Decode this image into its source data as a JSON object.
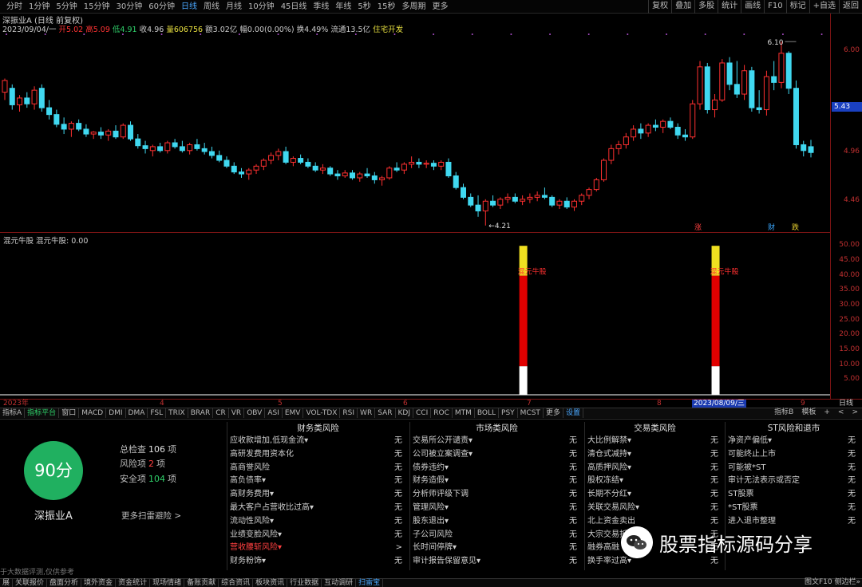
{
  "toolbar": {
    "periods": [
      "分时",
      "1分钟",
      "5分钟",
      "15分钟",
      "30分钟",
      "60分钟",
      "日线",
      "周线",
      "月线",
      "10分钟",
      "45日线",
      "季线",
      "年线",
      "5秒",
      "15秒",
      "多周期",
      "更多"
    ],
    "active_period": "日线",
    "buttons": [
      "复权",
      "叠加",
      "多股",
      "统计",
      "画线",
      "F10",
      "标记",
      "+自选",
      "返回"
    ]
  },
  "chart": {
    "title": "深振业A (日线 前复权)",
    "info": {
      "date": "2023/09/04/一",
      "open_label": "开",
      "open": "5.02",
      "high_label": "高",
      "high": "5.09",
      "low_label": "低",
      "low": "4.91",
      "close_label": "收",
      "close": "4.96",
      "volume_label": "量",
      "volume": "606756",
      "amount_label": "额",
      "amount": "3.02亿",
      "amplitude_label": "幅",
      "amplitude": "0.00(0.00%)",
      "turnover_label": "换",
      "turnover": "4.49%",
      "float_label": "流通",
      "float": "13.5亿",
      "sector": "住宅开发"
    },
    "price_ticks": [
      "6.00",
      "4.96",
      "4.46"
    ],
    "current_price_flag": "5.43",
    "high_note": "6.10",
    "low_note": "4.21",
    "event_marks": [
      "涨",
      "财",
      "跌"
    ],
    "indicator": {
      "title": "混元牛股 混元牛股: 0.00",
      "ticks": [
        "50.00",
        "45.00",
        "40.00",
        "35.00",
        "30.00",
        "25.00",
        "20.00",
        "15.00",
        "10.00",
        "5.00"
      ],
      "signal_label": "混元牛股"
    },
    "dates": [
      "2023年",
      "4",
      "5",
      "6",
      "7",
      "8",
      "2023/08/09/三",
      "9"
    ],
    "day_button": "日线"
  },
  "chart_data": {
    "type": "candlestick",
    "title": "深振业A (日线 前复权)",
    "ylim": [
      4.2,
      6.15
    ],
    "candles": [
      [
        5.58,
        5.72,
        5.5,
        5.7
      ],
      [
        5.62,
        5.66,
        5.4,
        5.45
      ],
      [
        5.45,
        5.55,
        5.38,
        5.52
      ],
      [
        5.52,
        5.58,
        5.42,
        5.46
      ],
      [
        5.46,
        5.64,
        5.4,
        5.6
      ],
      [
        5.62,
        5.66,
        5.38,
        5.42
      ],
      [
        5.42,
        5.5,
        5.3,
        5.35
      ],
      [
        5.35,
        5.4,
        5.22,
        5.25
      ],
      [
        5.25,
        5.32,
        5.15,
        5.2
      ],
      [
        5.2,
        5.28,
        5.12,
        5.26
      ],
      [
        5.26,
        5.3,
        5.18,
        5.2
      ],
      [
        5.2,
        5.25,
        5.12,
        5.15
      ],
      [
        5.15,
        5.18,
        5.1,
        5.17
      ],
      [
        5.17,
        5.22,
        5.1,
        5.14
      ],
      [
        5.14,
        5.2,
        5.08,
        5.18
      ],
      [
        5.18,
        5.24,
        5.1,
        5.12
      ],
      [
        5.12,
        5.26,
        5.1,
        5.24
      ],
      [
        5.24,
        5.28,
        5.08,
        5.1
      ],
      [
        5.1,
        5.15,
        5.0,
        5.03
      ],
      [
        5.03,
        5.08,
        4.95,
        5.0
      ],
      [
        4.98,
        5.04,
        4.92,
        5.02
      ],
      [
        5.02,
        5.06,
        4.96,
        4.98
      ],
      [
        4.98,
        5.08,
        4.95,
        5.06
      ],
      [
        5.06,
        5.1,
        5.0,
        5.02
      ],
      [
        5.02,
        5.08,
        4.96,
        4.98
      ],
      [
        4.98,
        5.06,
        4.94,
        5.04
      ],
      [
        5.04,
        5.1,
        4.98,
        5.0
      ],
      [
        5.0,
        5.06,
        4.94,
        4.97
      ],
      [
        4.97,
        5.02,
        4.9,
        4.93
      ],
      [
        4.93,
        4.98,
        4.86,
        4.88
      ],
      [
        4.88,
        4.92,
        4.8,
        4.82
      ],
      [
        4.82,
        4.86,
        4.74,
        4.76
      ],
      [
        4.76,
        4.8,
        4.7,
        4.74
      ],
      [
        4.74,
        4.8,
        4.68,
        4.78
      ],
      [
        4.78,
        4.84,
        4.74,
        4.82
      ],
      [
        4.82,
        4.9,
        4.78,
        4.88
      ],
      [
        4.88,
        4.96,
        4.84,
        4.93
      ],
      [
        4.93,
        5.0,
        4.88,
        4.97
      ],
      [
        4.97,
        5.02,
        4.84,
        4.86
      ],
      [
        4.86,
        4.92,
        4.82,
        4.9
      ],
      [
        4.9,
        4.94,
        4.84,
        4.86
      ],
      [
        4.86,
        4.9,
        4.8,
        4.82
      ],
      [
        4.82,
        4.86,
        4.76,
        4.78
      ],
      [
        4.78,
        4.84,
        4.74,
        4.8
      ],
      [
        4.8,
        4.82,
        4.72,
        4.74
      ],
      [
        4.74,
        4.78,
        4.68,
        4.72
      ],
      [
        4.72,
        4.78,
        4.7,
        4.75
      ],
      [
        4.75,
        4.78,
        4.68,
        4.7
      ],
      [
        4.7,
        4.76,
        4.66,
        4.74
      ],
      [
        4.74,
        4.8,
        4.7,
        4.72
      ],
      [
        4.72,
        4.76,
        4.64,
        4.68
      ],
      [
        4.68,
        4.72,
        4.62,
        4.7
      ],
      [
        4.7,
        4.82,
        4.68,
        4.8
      ],
      [
        4.8,
        4.86,
        4.76,
        4.78
      ],
      [
        4.78,
        4.86,
        4.74,
        4.84
      ],
      [
        4.84,
        4.92,
        4.8,
        4.86
      ],
      [
        4.86,
        4.9,
        4.8,
        4.84
      ],
      [
        4.84,
        4.88,
        4.8,
        4.85
      ],
      [
        4.85,
        4.88,
        4.78,
        4.82
      ],
      [
        4.82,
        4.88,
        4.78,
        4.86
      ],
      [
        4.86,
        4.9,
        4.7,
        4.72
      ],
      [
        4.72,
        4.76,
        4.58,
        4.6
      ],
      [
        4.6,
        4.64,
        4.48,
        4.5
      ],
      [
        4.5,
        4.54,
        4.4,
        4.42
      ],
      [
        4.42,
        4.52,
        4.3,
        4.36
      ],
      [
        4.36,
        4.48,
        4.21,
        4.46
      ],
      [
        4.46,
        4.52,
        4.4,
        4.42
      ],
      [
        4.42,
        4.5,
        4.38,
        4.48
      ],
      [
        4.48,
        4.54,
        4.44,
        4.5
      ],
      [
        4.5,
        4.54,
        4.44,
        4.46
      ],
      [
        4.46,
        4.52,
        4.42,
        4.48
      ],
      [
        4.48,
        4.54,
        4.44,
        4.5
      ],
      [
        4.5,
        4.56,
        4.46,
        4.52
      ],
      [
        4.52,
        4.6,
        4.48,
        4.5
      ],
      [
        4.5,
        4.52,
        4.4,
        4.42
      ],
      [
        4.42,
        4.48,
        4.38,
        4.46
      ],
      [
        4.46,
        4.5,
        4.38,
        4.4
      ],
      [
        4.4,
        4.48,
        4.36,
        4.46
      ],
      [
        4.46,
        4.54,
        4.42,
        4.52
      ],
      [
        4.52,
        4.6,
        4.48,
        4.58
      ],
      [
        4.58,
        4.7,
        4.56,
        4.68
      ],
      [
        4.68,
        4.9,
        4.66,
        4.88
      ],
      [
        4.88,
        5.04,
        4.84,
        5.0
      ],
      [
        5.0,
        5.08,
        4.94,
        5.04
      ],
      [
        5.04,
        5.16,
        5.0,
        5.12
      ],
      [
        5.12,
        5.24,
        5.08,
        5.2
      ],
      [
        5.2,
        5.26,
        5.1,
        5.16
      ],
      [
        5.16,
        5.26,
        5.12,
        5.24
      ],
      [
        5.24,
        5.3,
        5.18,
        5.22
      ],
      [
        5.22,
        5.3,
        5.16,
        5.28
      ],
      [
        5.28,
        5.32,
        5.2,
        5.22
      ],
      [
        5.22,
        5.26,
        5.1,
        5.14
      ],
      [
        5.14,
        5.2,
        5.08,
        5.12
      ],
      [
        5.12,
        5.5,
        5.1,
        5.46
      ],
      [
        5.46,
        5.9,
        5.4,
        5.84
      ],
      [
        5.84,
        5.88,
        5.36,
        5.4
      ],
      [
        5.4,
        5.56,
        5.32,
        5.5
      ],
      [
        5.5,
        5.92,
        5.48,
        5.88
      ],
      [
        5.88,
        5.94,
        5.6,
        5.66
      ],
      [
        5.66,
        5.9,
        5.52,
        5.56
      ],
      [
        5.56,
        5.86,
        5.5,
        5.8
      ],
      [
        5.8,
        5.84,
        5.38,
        5.42
      ],
      [
        5.42,
        5.6,
        5.36,
        5.4
      ],
      [
        5.4,
        5.8,
        5.34,
        5.74
      ],
      [
        5.74,
        5.9,
        5.6,
        5.68
      ],
      [
        5.68,
        6.1,
        5.62,
        5.98
      ],
      [
        5.98,
        6.0,
        5.56,
        5.62
      ],
      [
        5.62,
        5.7,
        5.0,
        5.04
      ],
      [
        5.04,
        5.08,
        4.92,
        4.98
      ],
      [
        5.02,
        5.09,
        4.91,
        4.96
      ]
    ],
    "indicator_signals": [
      {
        "at_candle": 70,
        "white_to": 9.6,
        "red_to": 40.0,
        "yellow_to": 50.0
      },
      {
        "at_candle": 96,
        "white_to": 9.6,
        "red_to": 40.0,
        "yellow_to": 50.0
      }
    ],
    "indicator_ylim": [
      0,
      53
    ]
  },
  "tabs": {
    "left": [
      "指标A",
      "指标平台",
      "窗口",
      "MACD",
      "DMI",
      "DMA",
      "FSL",
      "TRIX",
      "BRAR",
      "CR",
      "VR",
      "OBV",
      "ASI",
      "EMV",
      "VOL-TDX",
      "RSI",
      "WR",
      "SAR",
      "KDJ",
      "CCI",
      "ROC",
      "MTM",
      "BOLL",
      "PSY",
      "MCST",
      "更多",
      "设置"
    ],
    "right": [
      "指标B",
      "模板",
      "+",
      "<",
      ">"
    ]
  },
  "risk": {
    "score": "90分",
    "stock": "深振业A",
    "total_label": "总检查",
    "total": "106",
    "total_unit": "项",
    "risk_label": "风险项",
    "risk": "2",
    "risk_unit": "项",
    "safe_label": "安全项",
    "safe": "104",
    "safe_unit": "项",
    "more": "更多扫雷避险 >",
    "footnote": "于大数据评测,仅供参考",
    "columns": [
      {
        "title": "财务类风险",
        "rows": [
          {
            "name": "应收款增加,低现金流▾",
            "status": "无"
          },
          {
            "name": "高研发费用资本化",
            "status": "无"
          },
          {
            "name": "高商誉风险",
            "status": "无"
          },
          {
            "name": "高负债率▾",
            "status": "无"
          },
          {
            "name": "高财务费用▾",
            "status": "无"
          },
          {
            "name": "最大客户占营收比过高▾",
            "status": "无"
          },
          {
            "name": "流动性风险▾",
            "status": "无"
          },
          {
            "name": "业绩变脸风险▾",
            "status": "无"
          },
          {
            "name": "营收腰斩风险▾",
            "status": ">"
          },
          {
            "name": "财务粉饰▾",
            "status": "无"
          }
        ]
      },
      {
        "title": "市场类风险",
        "rows": [
          {
            "name": "交易所公开谴责▾",
            "status": "无"
          },
          {
            "name": "公司被立案调查▾",
            "status": "无"
          },
          {
            "name": "债券违约▾",
            "status": "无"
          },
          {
            "name": "财务造假▾",
            "status": "无"
          },
          {
            "name": "分析师评级下调",
            "status": "无"
          },
          {
            "name": "管理风险▾",
            "status": "无"
          },
          {
            "name": "股东退出▾",
            "status": "无"
          },
          {
            "name": "子公司风险",
            "status": "无"
          },
          {
            "name": "长时间停牌▾",
            "status": "无"
          },
          {
            "name": "审计报告保留意见▾",
            "status": "无"
          }
        ]
      },
      {
        "title": "交易类风险",
        "rows": [
          {
            "name": "大比例解禁▾",
            "status": "无"
          },
          {
            "name": "清仓式减持▾",
            "status": "无"
          },
          {
            "name": "高质押风险▾",
            "status": "无"
          },
          {
            "name": "股权冻结▾",
            "status": "无"
          },
          {
            "name": "长期不分红▾",
            "status": "无"
          },
          {
            "name": "关联交易风险▾",
            "status": "无"
          },
          {
            "name": "北上资金卖出",
            "status": "无"
          },
          {
            "name": "大宗交易折",
            "status": "无"
          },
          {
            "name": "融券高融",
            "status": "无"
          },
          {
            "name": "换手率过高▾",
            "status": "无"
          }
        ]
      },
      {
        "title": "ST风险和退市",
        "rows": [
          {
            "name": "净资产偏低▾",
            "status": "无"
          },
          {
            "name": "可能终止上市",
            "status": "无"
          },
          {
            "name": "可能被*ST",
            "status": "无"
          },
          {
            "name": "审计无法表示或否定",
            "status": "无"
          },
          {
            "name": "ST股票",
            "status": "无"
          },
          {
            "name": "*ST股票",
            "status": "无"
          },
          {
            "name": "进入退市整理",
            "status": "无"
          }
        ]
      }
    ]
  },
  "watermark": "股票指标源码分享",
  "bottom": {
    "tabs": [
      "展",
      "关联报价",
      "盘面分析",
      "境外资金",
      "资金统计",
      "现场情绪",
      "备账贡献",
      "综合资讯",
      "板块资讯",
      "行业数据",
      "互动调研",
      "扫雷宝"
    ],
    "active": "扫雷宝",
    "right": "图文F10  侧边栏»"
  }
}
